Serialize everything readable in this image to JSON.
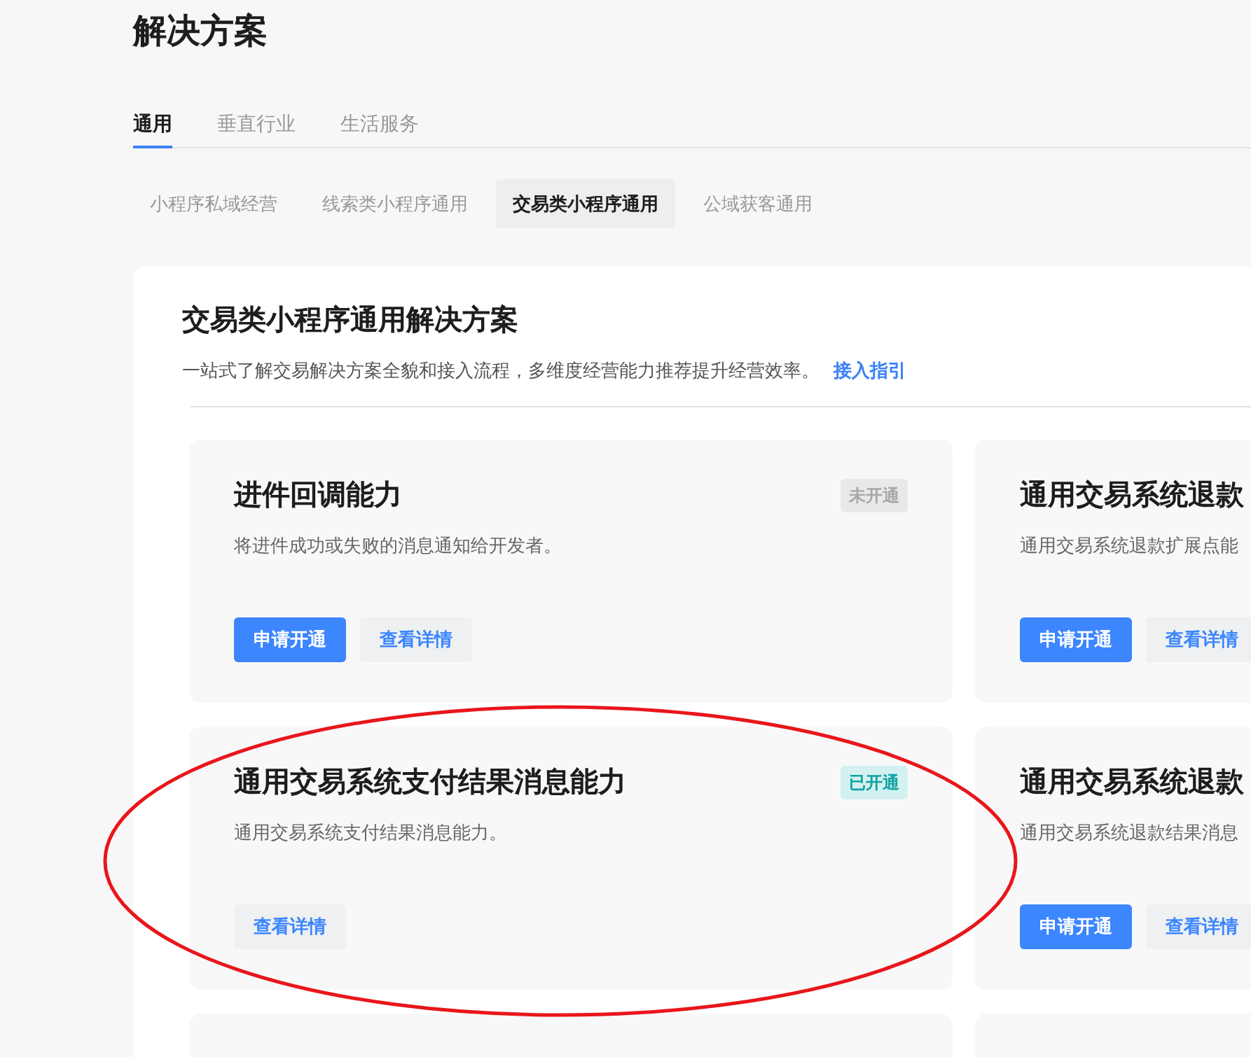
{
  "page_title": "解决方案",
  "tabs": [
    {
      "label": "通用",
      "selected": true
    },
    {
      "label": "垂直行业",
      "selected": false
    },
    {
      "label": "生活服务",
      "selected": false
    }
  ],
  "subtabs": [
    {
      "label": "小程序私域经营",
      "selected": false
    },
    {
      "label": "线索类小程序通用",
      "selected": false
    },
    {
      "label": "交易类小程序通用",
      "selected": true
    },
    {
      "label": "公域获客通用",
      "selected": false
    }
  ],
  "panel": {
    "title": "交易类小程序通用解决方案",
    "description": "一站式了解交易解决方案全貌和接入流程，多维度经营能力推荐提升经营效率。",
    "link": "接入指引"
  },
  "cards": [
    {
      "kind": "capability",
      "title": "进件回调能力",
      "status": {
        "kind": "not_open",
        "label": "未开通"
      },
      "description": "将进件成功或失败的消息通知给开发者。",
      "buttons": [
        {
          "kind": "primary",
          "label": "申请开通"
        },
        {
          "kind": "secondary",
          "label": "查看详情"
        }
      ]
    },
    {
      "kind": "capability",
      "title": "通用交易系统退款",
      "description": "通用交易系统退款扩展点能",
      "buttons": [
        {
          "kind": "primary",
          "label": "申请开通"
        },
        {
          "kind": "secondary",
          "label": "查看详情"
        }
      ]
    },
    {
      "kind": "capability",
      "title": "通用交易系统支付结果消息能力",
      "status": {
        "kind": "open",
        "label": "已开通"
      },
      "description": "通用交易系统支付结果消息能力。",
      "buttons": [
        {
          "kind": "secondary",
          "label": "查看详情"
        }
      ]
    },
    {
      "kind": "capability",
      "title": "通用交易系统退款",
      "description": "通用交易系统退款结果消息",
      "buttons": [
        {
          "kind": "primary",
          "label": "申请开通"
        },
        {
          "kind": "secondary",
          "label": "查看详情"
        }
      ]
    },
    {
      "kind": "blank"
    },
    {
      "kind": "blank"
    }
  ]
}
